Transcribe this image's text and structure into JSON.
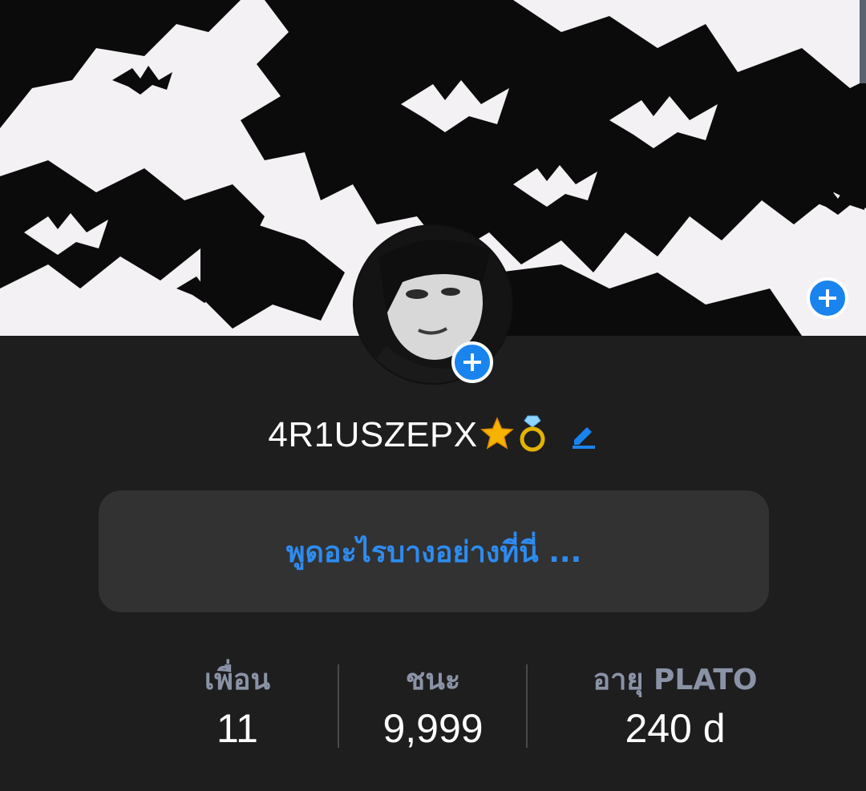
{
  "profile": {
    "username": "4R1USZEPX",
    "status_placeholder": "พูดอะไรบางอย่างที่นี่ ..."
  },
  "stats": [
    {
      "label": "เพื่อน",
      "value": "11"
    },
    {
      "label": "ชนะ",
      "value": "9,999"
    },
    {
      "label": "อายุ PLATO",
      "value": "240 d"
    }
  ],
  "icons": {
    "cover_add": "plus-circle-icon",
    "avatar_add": "plus-circle-icon",
    "badge1": "star-icon",
    "badge2": "ring-icon",
    "edit": "pencil-icon"
  },
  "colors": {
    "accent": "#1a84ee",
    "background": "#1e1e1f",
    "status_text": "#2d8cf0",
    "label": "#8a93a6"
  }
}
